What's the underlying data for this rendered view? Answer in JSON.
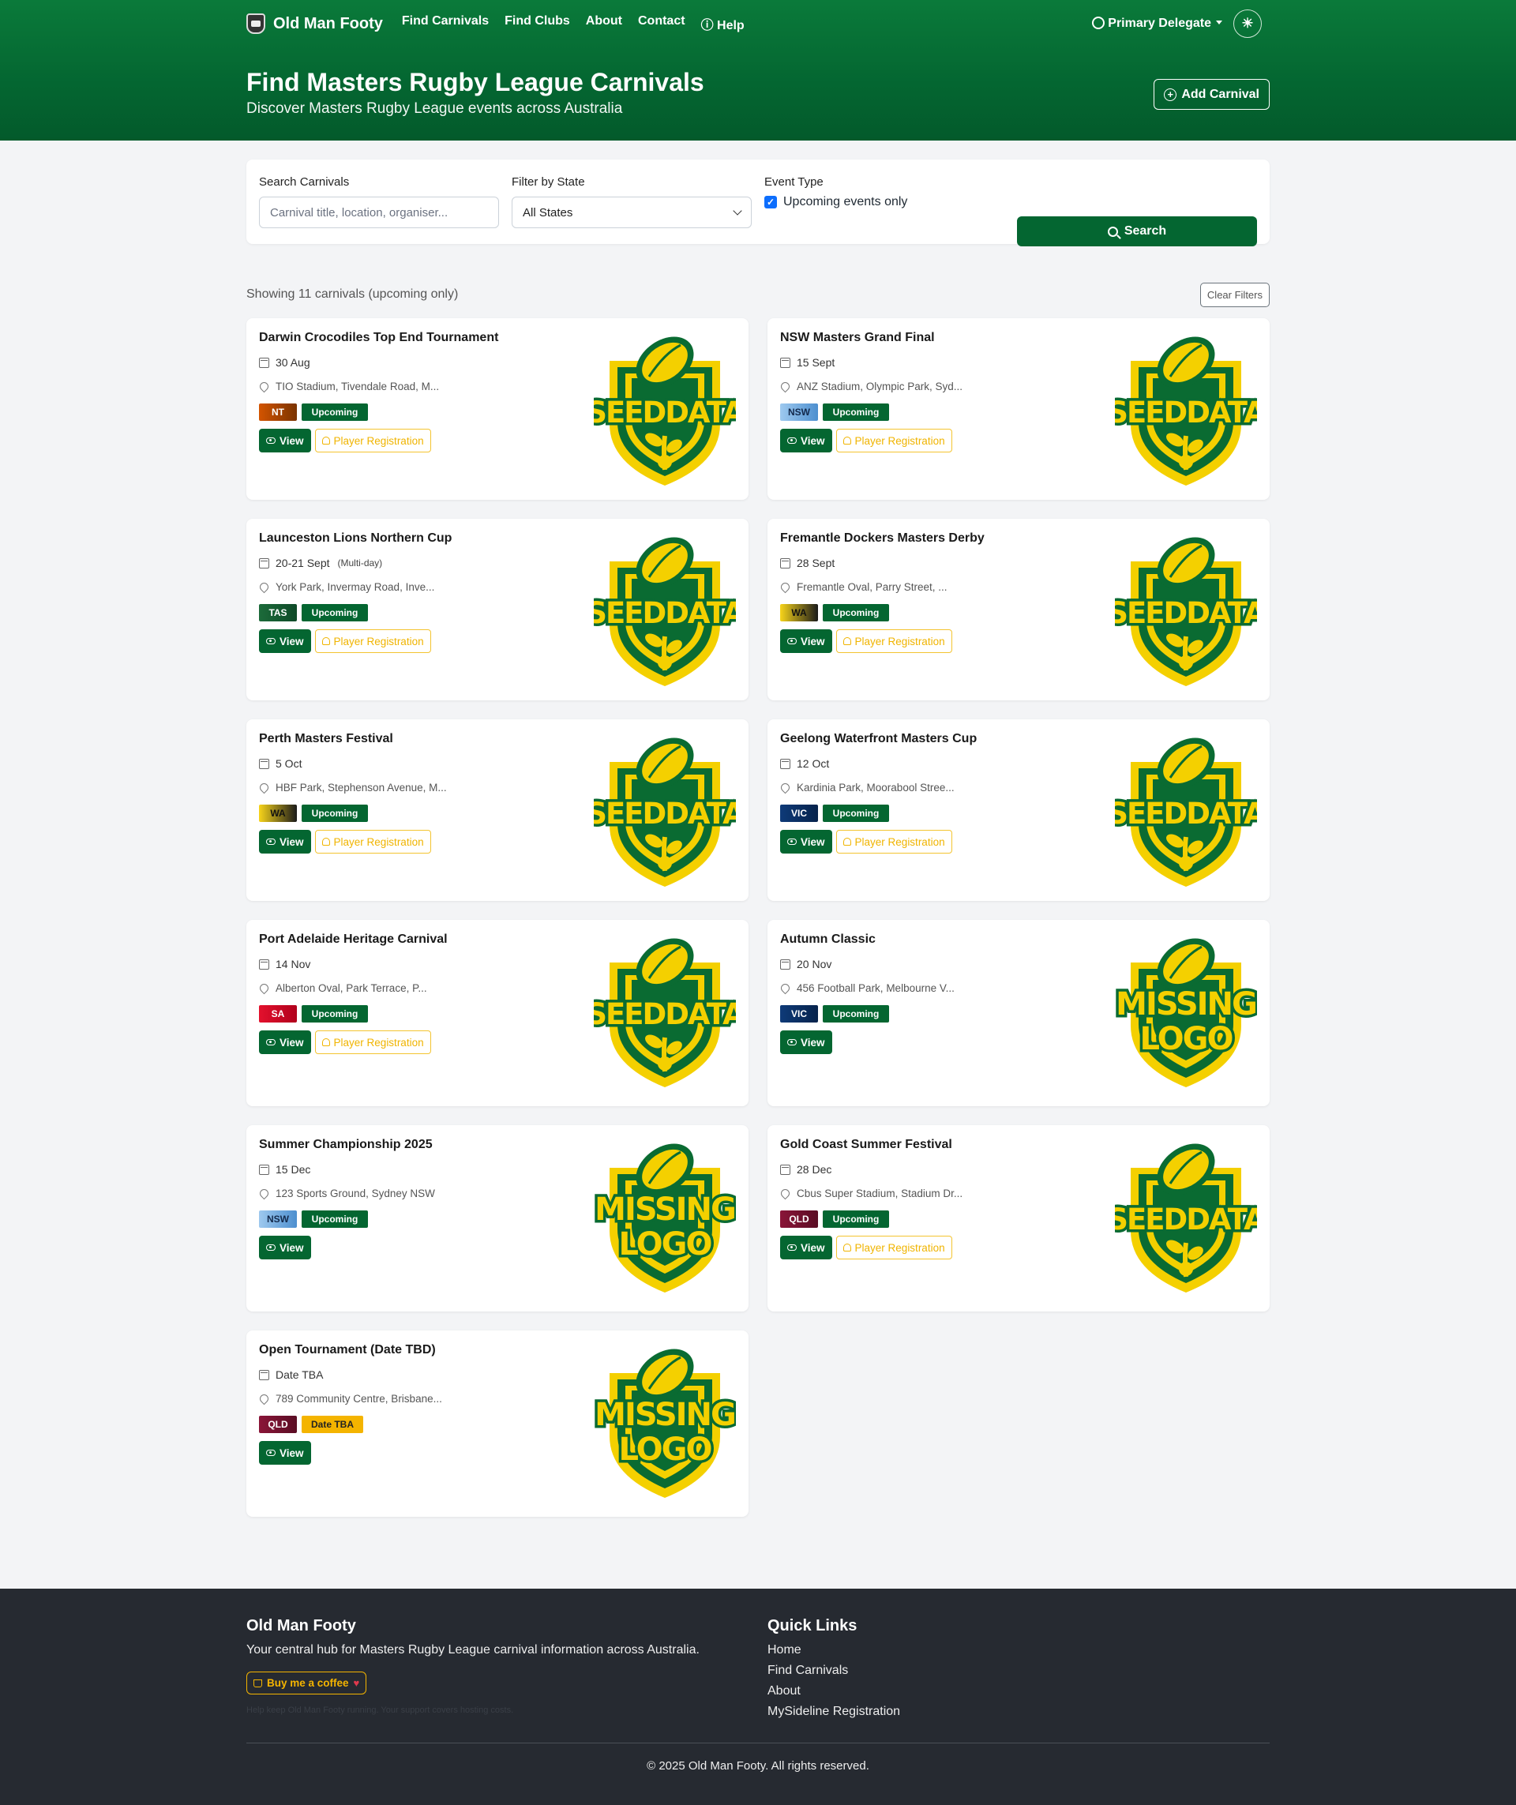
{
  "nav": {
    "brand": "Old Man Footy",
    "links": [
      "Find Carnivals",
      "Find Clubs",
      "About",
      "Contact",
      "Help"
    ],
    "user": "Primary Delegate"
  },
  "hero": {
    "title": "Find Masters Rugby League Carnivals",
    "subtitle": "Discover Masters Rugby League events across Australia",
    "add_button": "Add Carnival"
  },
  "filters": {
    "search_label": "Search Carnivals",
    "search_placeholder": "Carnival title, location, organiser...",
    "state_label": "Filter by State",
    "state_value": "All States",
    "type_label": "Event Type",
    "upcoming_label": "Upcoming events only",
    "upcoming_checked": true,
    "search_button": "Search"
  },
  "results": {
    "summary": "Showing 11 carnivals (upcoming only)",
    "clear_button": "Clear Filters"
  },
  "carnivals": [
    {
      "title": "Darwin Crocodiles Top End Tournament",
      "date": "30 Aug",
      "location": "TIO Stadium, Tivendale Road, M...",
      "state": "NT",
      "status": "Upcoming",
      "logo": "SEED DATA",
      "registration": true
    },
    {
      "title": "NSW Masters Grand Final",
      "date": "15 Sept",
      "location": "ANZ Stadium, Olympic Park, Syd...",
      "state": "NSW",
      "status": "Upcoming",
      "logo": "SEED DATA",
      "registration": true
    },
    {
      "title": "Launceston Lions Northern Cup",
      "date": "20-21 Sept",
      "note": "(Multi-day)",
      "location": "York Park, Invermay Road, Inve...",
      "state": "TAS",
      "status": "Upcoming",
      "logo": "SEED DATA",
      "registration": true
    },
    {
      "title": "Fremantle Dockers Masters Derby",
      "date": "28 Sept",
      "location": "Fremantle Oval, Parry Street, ...",
      "state": "WA",
      "status": "Upcoming",
      "logo": "SEED DATA",
      "registration": true
    },
    {
      "title": "Perth Masters Festival",
      "date": "5 Oct",
      "location": "HBF Park, Stephenson Avenue, M...",
      "state": "WA",
      "status": "Upcoming",
      "logo": "SEED DATA",
      "registration": true
    },
    {
      "title": "Geelong Waterfront Masters Cup",
      "date": "12 Oct",
      "location": "Kardinia Park, Moorabool Stree...",
      "state": "VIC",
      "status": "Upcoming",
      "logo": "SEED DATA",
      "registration": true
    },
    {
      "title": "Port Adelaide Heritage Carnival",
      "date": "14 Nov",
      "location": "Alberton Oval, Park Terrace, P...",
      "state": "SA",
      "status": "Upcoming",
      "logo": "SEED DATA",
      "registration": true
    },
    {
      "title": "Autumn Classic",
      "date": "20 Nov",
      "location": "456 Football Park, Melbourne V...",
      "state": "VIC",
      "status": "Upcoming",
      "logo": "MISSING LOGO",
      "registration": false
    },
    {
      "title": "Summer Championship 2025",
      "date": "15 Dec",
      "location": "123 Sports Ground, Sydney NSW",
      "state": "NSW",
      "status": "Upcoming",
      "logo": "MISSING LOGO",
      "registration": false
    },
    {
      "title": "Gold Coast Summer Festival",
      "date": "28 Dec",
      "location": "Cbus Super Stadium, Stadium Dr...",
      "state": "QLD",
      "status": "Upcoming",
      "logo": "SEED DATA",
      "registration": true
    },
    {
      "title": "Open Tournament (Date TBD)",
      "date": "Date TBA",
      "location": "789 Community Centre, Brisbane...",
      "state": "QLD",
      "status": "Date TBA",
      "logo": "MISSING LOGO",
      "registration": false
    }
  ],
  "card_labels": {
    "view": "View",
    "register": "Player Registration"
  },
  "footer": {
    "title": "Old Man Footy",
    "tagline": "Your central hub for Masters Rugby League carnival information across Australia.",
    "coffee": "Buy me a coffee",
    "small_note": "Help keep Old Man Footy running. Your support covers hosting costs.",
    "links_title": "Quick Links",
    "links": [
      "Home",
      "Find Carnivals",
      "About",
      "MySideline Registration"
    ],
    "copyright": "© 2025 Old Man Footy. All rights reserved."
  },
  "colors": {
    "primary": "#046631",
    "accent": "#f4b400",
    "footer": "#262a31"
  }
}
